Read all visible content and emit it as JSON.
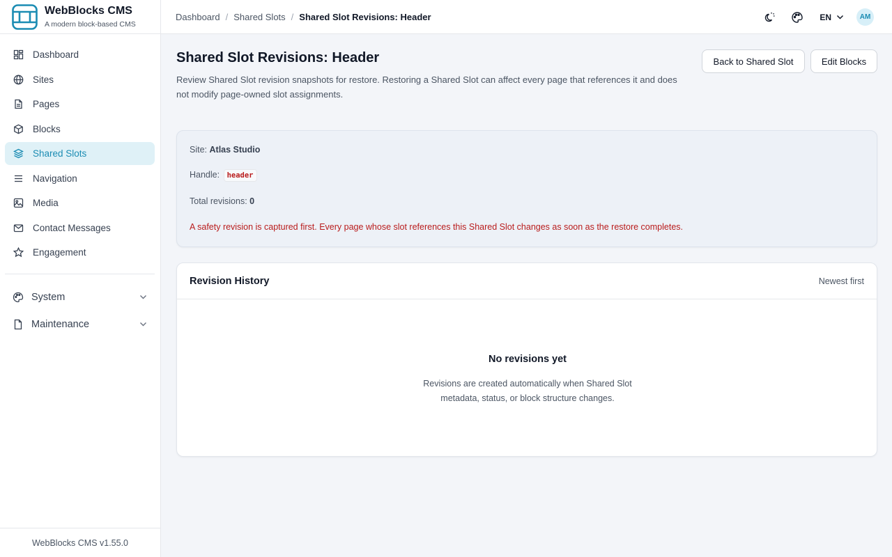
{
  "brand": {
    "name": "WebBlocks CMS",
    "tagline": "A modern block-based CMS"
  },
  "sidebar": {
    "items": [
      {
        "label": "Dashboard",
        "icon": "dashboard-icon",
        "active": false
      },
      {
        "label": "Sites",
        "icon": "globe-icon",
        "active": false
      },
      {
        "label": "Pages",
        "icon": "file-text-icon",
        "active": false
      },
      {
        "label": "Blocks",
        "icon": "box-icon",
        "active": false
      },
      {
        "label": "Shared Slots",
        "icon": "layers-icon",
        "active": true
      },
      {
        "label": "Navigation",
        "icon": "menu-icon",
        "active": false
      },
      {
        "label": "Media",
        "icon": "image-icon",
        "active": false
      },
      {
        "label": "Contact Messages",
        "icon": "mail-icon",
        "active": false
      },
      {
        "label": "Engagement",
        "icon": "star-icon",
        "active": false
      }
    ],
    "groups": [
      {
        "label": "System",
        "icon": "palette-icon"
      },
      {
        "label": "Maintenance",
        "icon": "file-icon"
      }
    ],
    "version": "WebBlocks CMS v1.55.0"
  },
  "breadcrumb": [
    "Dashboard",
    "Shared Slots",
    "Shared Slot Revisions: Header"
  ],
  "topbar": {
    "language": "EN",
    "avatar_initials": "AM"
  },
  "page": {
    "title": "Shared Slot Revisions: Header",
    "description": "Review Shared Slot revision snapshots for restore. Restoring a Shared Slot can affect every page that references it and does not modify page-owned slot assignments.",
    "back_button": "Back to Shared Slot",
    "edit_button": "Edit Blocks"
  },
  "info": {
    "site_label": "Site:",
    "site_value": "Atlas Studio",
    "handle_label": "Handle:",
    "handle_value": "header",
    "total_label": "Total revisions:",
    "total_value": "0",
    "warning": "A safety revision is captured first. Every page whose slot references this Shared Slot changes as soon as the restore completes."
  },
  "history": {
    "title": "Revision History",
    "sort": "Newest first",
    "empty_title": "No revisions yet",
    "empty_desc": "Revisions are created automatically when Shared Slot metadata, status, or block structure changes."
  },
  "colors": {
    "accent": "#1b8cb3",
    "active_bg": "#dff1f7",
    "danger": "#b91c1c"
  }
}
